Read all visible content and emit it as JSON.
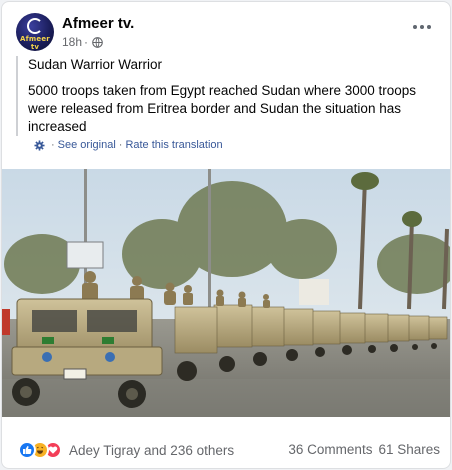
{
  "post": {
    "page_name": "Afmeer tv.",
    "avatar_text": "Afmeer tv",
    "timestamp": "18h",
    "separator": "·",
    "original_text": "Sudan Warrior Warrior",
    "translated_text": "5000 troops taken from Egypt reached Sudan where 3000 troops were released from Eritrea border and Sudan the situation has increased",
    "see_original": "See original",
    "link_separator": "·",
    "rate_translation": "Rate this translation"
  },
  "footer": {
    "reactors": "Adey Tigray and 236 others",
    "comments": "36 Comments",
    "shares": "61 Shares"
  },
  "icons": {
    "privacy": "globe-icon",
    "translate": "gear-icon",
    "menu": "more-icon",
    "reactions": [
      "like-icon",
      "haha-icon",
      "love-icon"
    ]
  },
  "colors": {
    "link": "#385898",
    "like": "#1877f2",
    "haha": "#f7b125",
    "love": "#f33e58",
    "secondary_text": "#65676b"
  }
}
